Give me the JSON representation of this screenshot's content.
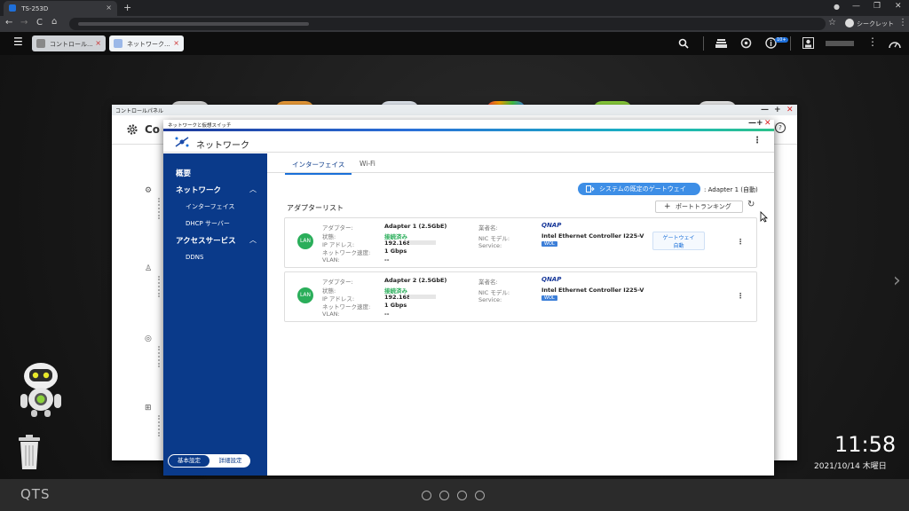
{
  "browser": {
    "tab_title": "TS-253D",
    "tab_close": "×",
    "new_tab": "+",
    "win_min": "—",
    "win_max": "❐",
    "win_close": "✕",
    "back": "←",
    "forward": "→",
    "reload": "C",
    "home": "⌂",
    "star": "☆",
    "incognito_label": "シークレット",
    "menu": "⋮"
  },
  "qts": {
    "menu_icon": "☰",
    "tabs": [
      {
        "label": "コントロール...",
        "icon": "gear-icon"
      },
      {
        "label": "ネットワーク...",
        "icon": "network-icon"
      }
    ],
    "tab_close": "×",
    "notification_badge": "10+",
    "search": "🔍",
    "more": "⋮"
  },
  "control_panel": {
    "title": "コントロールパネル",
    "heading": "Co",
    "min": "—",
    "max": "+",
    "close": "✕",
    "help": "?"
  },
  "network_window": {
    "titlebar": "ネットワークと仮想スイッチ",
    "title": "ネットワーク",
    "min": "—",
    "max": "+",
    "close": "✕",
    "more": "⋮",
    "sidebar": {
      "overview": "概要",
      "network": "ネットワーク",
      "interface": "インターフェイス",
      "dhcp": "DHCP サーバー",
      "access": "アクセスサービス",
      "ddns": "DDNS",
      "chevron": "︿"
    },
    "mode_toggle": {
      "basic": "基本設定",
      "advanced": "詳細設定"
    },
    "tabs": {
      "interface": "インターフェイス",
      "wifi": "Wi-Fi"
    },
    "default_gateway_button": "システムの既定のゲートウェイ",
    "default_gateway_value": ": Adapter 1 (自動)",
    "adapter_list_title": "アダプターリスト",
    "port_trunking_button": "ポートトランキング",
    "refresh": "↻",
    "labels": {
      "adapter": "アダプター:",
      "status": "状態:",
      "ip": "IP アドレス:",
      "speed": "ネットワーク速度:",
      "vlan": "VLAN:",
      "vendor": "業者名:",
      "nic_model": "NIC モデル:",
      "service": "Service:"
    },
    "adapters": [
      {
        "name": "Adapter 1 (2.5GbE)",
        "status": "接続済み",
        "ip": "192.168.",
        "speed": "1 Gbps",
        "vlan": "--",
        "vendor": "QNAP",
        "nic": "Intel Ethernet Controller I225-V",
        "service": "WOL",
        "gateway_chip": "ゲートウェイ",
        "gateway_mode": "自動",
        "icon_label": "LAN"
      },
      {
        "name": "Adapter 2 (2.5GbE)",
        "status": "接続済み",
        "ip": "192.168.",
        "speed": "1 Gbps",
        "vlan": "--",
        "vendor": "QNAP",
        "nic": "Intel Ethernet Controller I225-V",
        "service": "WOL",
        "icon_label": "LAN"
      }
    ]
  },
  "desktop": {
    "time": "11:58",
    "date": "2021/10/14 木曜日",
    "logo": "QTS",
    "next_arrow": "›"
  }
}
